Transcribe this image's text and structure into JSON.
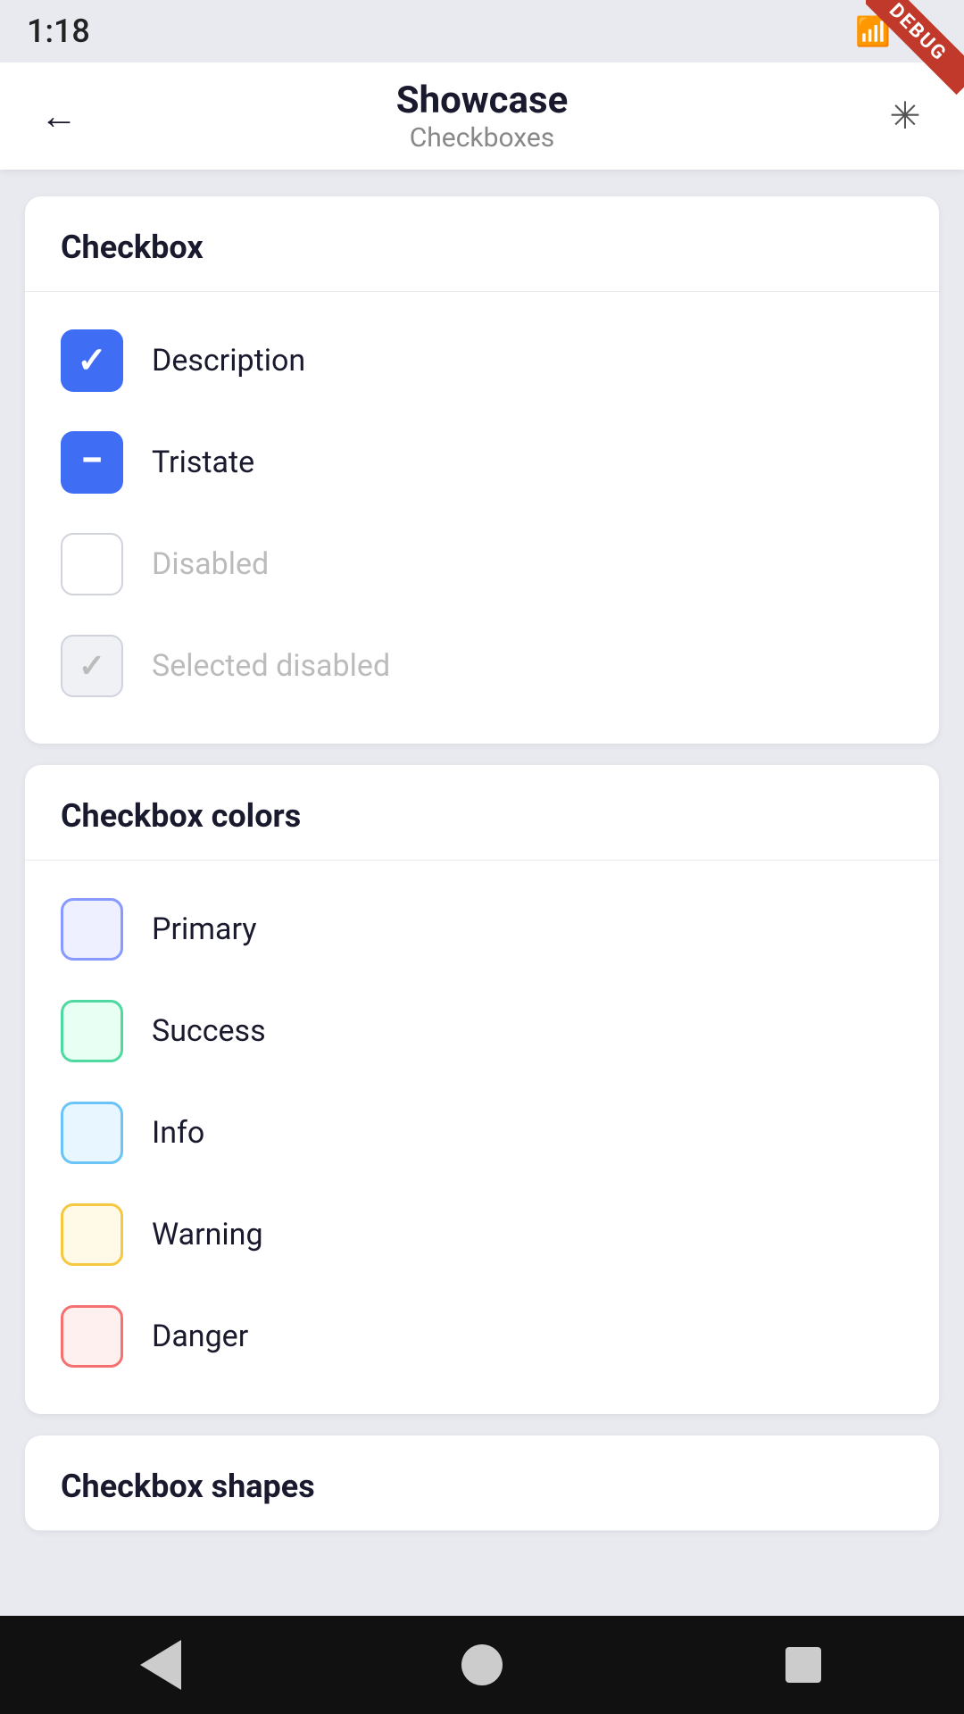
{
  "statusBar": {
    "time": "1:18",
    "debugLabel": "DEBUG"
  },
  "appBar": {
    "title": "Showcase",
    "subtitle": "Checkboxes",
    "backLabel": "←",
    "themeLabel": "☀"
  },
  "checkboxSection": {
    "title": "Checkbox",
    "items": [
      {
        "id": "description",
        "label": "Description",
        "state": "checked",
        "disabled": false
      },
      {
        "id": "tristate",
        "label": "Tristate",
        "state": "tristate",
        "disabled": false
      },
      {
        "id": "disabled",
        "label": "Disabled",
        "state": "unchecked",
        "disabled": true
      },
      {
        "id": "selected-disabled",
        "label": "Selected disabled",
        "state": "checked",
        "disabled": true
      }
    ]
  },
  "checkboxColorsSection": {
    "title": "Checkbox colors",
    "items": [
      {
        "id": "primary",
        "label": "Primary",
        "color": "primary"
      },
      {
        "id": "success",
        "label": "Success",
        "color": "success"
      },
      {
        "id": "info",
        "label": "Info",
        "color": "info"
      },
      {
        "id": "warning",
        "label": "Warning",
        "color": "warning"
      },
      {
        "id": "danger",
        "label": "Danger",
        "color": "danger"
      }
    ]
  },
  "checkboxShapesSection": {
    "title": "Checkbox shapes"
  },
  "bottomNav": {
    "back": "back",
    "home": "home",
    "recents": "recents"
  }
}
